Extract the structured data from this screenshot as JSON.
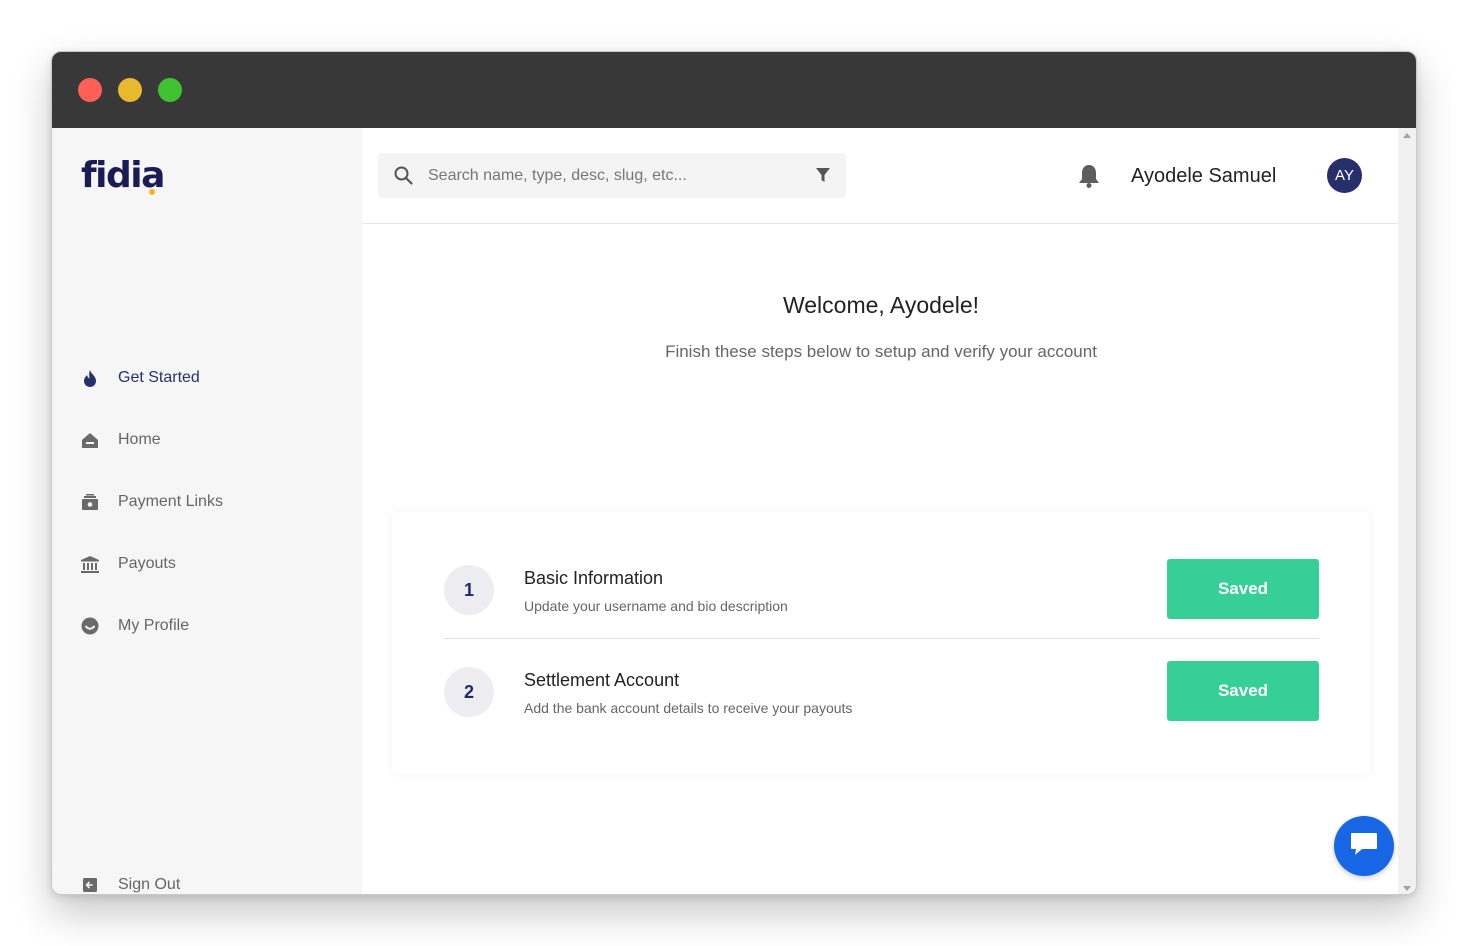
{
  "window": {
    "controls": [
      "close",
      "minimize",
      "maximize"
    ]
  },
  "sidebar": {
    "logo": "fidia",
    "items": [
      {
        "label": "Get Started",
        "icon": "flame-icon",
        "active": true
      },
      {
        "label": "Home",
        "icon": "home-icon",
        "active": false
      },
      {
        "label": "Payment Links",
        "icon": "payment-links-icon",
        "active": false
      },
      {
        "label": "Payouts",
        "icon": "bank-icon",
        "active": false
      },
      {
        "label": "My Profile",
        "icon": "profile-icon",
        "active": false
      }
    ],
    "sign_out": {
      "label": "Sign Out",
      "icon": "sign-out-icon"
    }
  },
  "header": {
    "search": {
      "placeholder": "Search name, type, desc, slug, etc...",
      "value": ""
    },
    "user_name": "Ayodele Samuel",
    "avatar_initials": "AY"
  },
  "main": {
    "welcome_title": "Welcome, Ayodele!",
    "welcome_subtitle": "Finish these steps below to setup and verify your account",
    "steps": [
      {
        "number": "1",
        "title": "Basic Information",
        "description": "Update your username and bio description",
        "button": "Saved"
      },
      {
        "number": "2",
        "title": "Settlement Account",
        "description": "Add the bank account details to receive your payouts",
        "button": "Saved"
      }
    ]
  },
  "colors": {
    "brand": "#1b1c55",
    "accent": "#f6b21f",
    "success": "#36cf97",
    "chat": "#1766e6",
    "titlebar": "#383838"
  }
}
